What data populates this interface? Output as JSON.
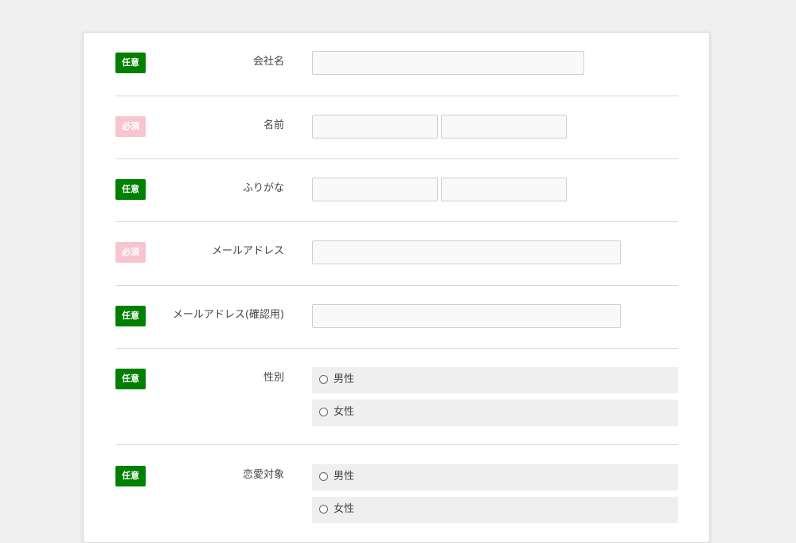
{
  "badges": {
    "optional": "任意",
    "required": "必須"
  },
  "fields": {
    "company": {
      "label": "会社名"
    },
    "name": {
      "label": "名前"
    },
    "furigana": {
      "label": "ふりがな"
    },
    "email": {
      "label": "メールアドレス"
    },
    "email_confirm": {
      "label": "メールアドレス(確認用)"
    },
    "gender": {
      "label": "性別",
      "options": [
        "男性",
        "女性"
      ]
    },
    "romance_target": {
      "label": "恋愛対象",
      "options": [
        "男性",
        "女性"
      ]
    }
  },
  "colors": {
    "optional_badge": "#008000",
    "required_badge": "#f7c5d1",
    "page_background": "#f0f0f0",
    "input_background": "#f9f9f9",
    "radio_background": "#efefef"
  }
}
